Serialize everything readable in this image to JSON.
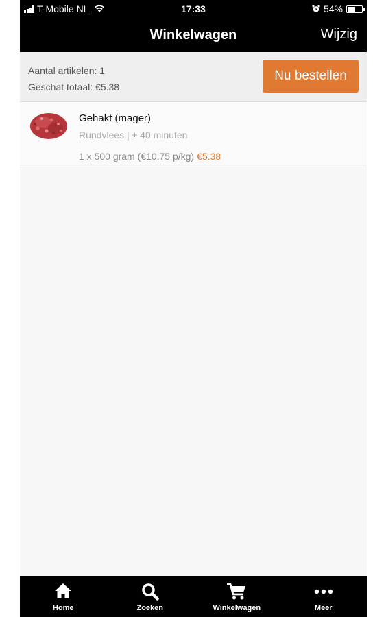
{
  "status_bar": {
    "carrier": "T-Mobile NL",
    "time": "17:33",
    "battery": "54%",
    "battery_level": 0.54
  },
  "nav": {
    "title": "Winkelwagen",
    "edit_label": "Wijzig"
  },
  "summary": {
    "item_count": "Aantal artikelen: 1",
    "estimated_total": "Geschat totaal: €5.38",
    "order_button": "Nu bestellen"
  },
  "cart": {
    "items": [
      {
        "name": "Gehakt (mager)",
        "subtitle": "Rundvlees | ± 40 minuten",
        "quantity_line": "1 x 500 gram (€10.75 p/kg)",
        "price": "€5.38"
      }
    ]
  },
  "tabs": [
    {
      "label": "Home",
      "icon": "home-icon"
    },
    {
      "label": "Zoeken",
      "icon": "search-icon"
    },
    {
      "label": "Winkelwagen",
      "icon": "cart-icon"
    },
    {
      "label": "Meer",
      "icon": "more-icon"
    }
  ],
  "colors": {
    "accent": "#e07a32",
    "bars": "#000000",
    "background": "#f7f7f7"
  }
}
